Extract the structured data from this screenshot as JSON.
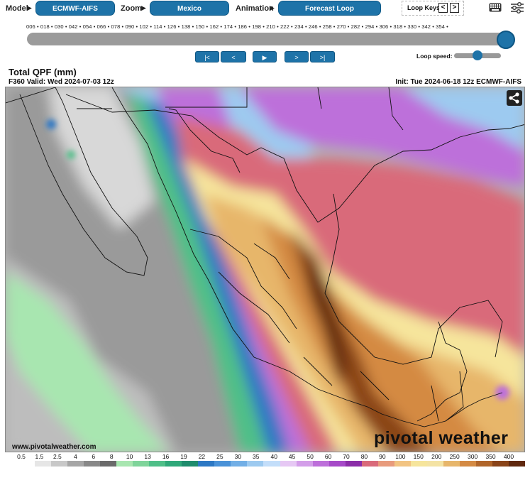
{
  "toolbar": {
    "model_label": "Model",
    "model_value": "ECMWF-AIFS",
    "zoom_label": "Zoom",
    "zoom_value": "Mexico",
    "animation_label": "Animation",
    "animation_value": "Forecast Loop",
    "loop_keys_label": "Loop Keys:",
    "loop_key_prev": "<",
    "loop_key_next": ">",
    "keyboard_icon": "keyboard-icon",
    "settings_icon": "sliders-icon"
  },
  "timeline": {
    "forecast_hours": [
      "006",
      "018",
      "030",
      "042",
      "054",
      "066",
      "078",
      "090",
      "102",
      "114",
      "126",
      "138",
      "150",
      "162",
      "174",
      "186",
      "198",
      "210",
      "222",
      "234",
      "246",
      "258",
      "270",
      "282",
      "294",
      "306",
      "318",
      "330",
      "342",
      "354"
    ],
    "current_position": 1.0
  },
  "controls": {
    "first": "|<",
    "prev": "<",
    "play": "▶",
    "next": ">",
    "last": ">|",
    "loop_speed_label": "Loop speed:",
    "loop_speed_value": 0.45
  },
  "header": {
    "title": "Total QPF (mm)",
    "valid": "F360 Valid: Wed 2024-07-03 12z",
    "init": "Init: Tue 2024-06-18 12z ECMWF-AIFS"
  },
  "map": {
    "watermark": "pivotal weather",
    "website": "www.pivotalweather.com",
    "share_icon": "share-icon"
  },
  "legend": {
    "labels": [
      "0.5",
      "1.5",
      "2.5",
      "4",
      "6",
      "8",
      "10",
      "13",
      "16",
      "19",
      "22",
      "25",
      "30",
      "35",
      "40",
      "45",
      "50",
      "60",
      "70",
      "80",
      "90",
      "100",
      "150",
      "200",
      "250",
      "300",
      "350",
      "400"
    ],
    "colors": [
      "#ffffff",
      "#e6e6e6",
      "#c8c8c8",
      "#a6a6a6",
      "#888888",
      "#6a6a6a",
      "#a8e6b0",
      "#7fd49a",
      "#4fbf88",
      "#2fa879",
      "#1f8c6d",
      "#2d78c4",
      "#4a92d8",
      "#72afe6",
      "#9dcaf0",
      "#c3defa",
      "#e6c8f4",
      "#d39ee9",
      "#bd6fda",
      "#a64ac8",
      "#8b2ea8",
      "#d96a7a",
      "#e89b7c",
      "#f2c482",
      "#f6e59c",
      "#f4e3a4",
      "#e7b66b",
      "#d48a43",
      "#b0652a",
      "#8a4419",
      "#60290f"
    ]
  }
}
